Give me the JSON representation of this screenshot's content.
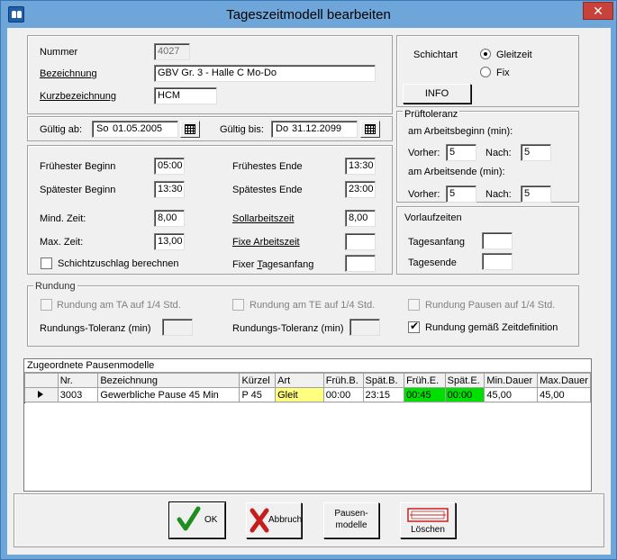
{
  "window": {
    "title": "Tageszeitmodell bearbeiten",
    "close_glyph": "✕"
  },
  "top": {
    "nummer_label": "Nummer",
    "nummer_value": "4027",
    "bezeichnung_label": "Bezeichnung",
    "bezeichnung_value": "GBV Gr. 3 - Halle C Mo-Do",
    "kurz_label": "Kurzbezeichnung",
    "kurz_value": "HCM"
  },
  "shift": {
    "label": "Schichtart",
    "gleitzeit": "Gleitzeit",
    "fix": "Fix",
    "selected": "Gleitzeit",
    "info_button": "INFO"
  },
  "validity": {
    "from_label": "Gültig ab:",
    "from_day": "So",
    "from_date": "01.05.2005",
    "to_label": "Gültig bis:",
    "to_day": "Do",
    "to_date": "31.12.2099"
  },
  "pruef": {
    "legend": "Prüftoleranz",
    "begin_label": "am Arbeitsbeginn (min):",
    "end_label": "am Arbeitsende (min):",
    "vorher_label": "Vorher:",
    "nach_label": "Nach:",
    "begin_vorher": "5",
    "begin_nach": "5",
    "end_vorher": "5",
    "end_nach": "5"
  },
  "times": {
    "fb_label": "Frühester Beginn",
    "fb_value": "05:00",
    "sb_label": "Spätester Beginn",
    "sb_value": "13:30",
    "fe_label": "Frühestes Ende",
    "fe_value": "13:30",
    "se_label": "Spätestes Ende",
    "se_value": "23:00",
    "mind_label": "Mind. Zeit:",
    "mind_value": "8,00",
    "max_label": "Max. Zeit:",
    "max_value": "13,00",
    "soll_label": "Sollarbeitszeit",
    "soll_value": "8,00",
    "fixe_label": "Fixe Arbeitszeit",
    "fixe_value": "",
    "fixta_label": "Fixer Tagesanfang",
    "fixta_value": "",
    "schicht_label": "Schichtzuschlag berechnen"
  },
  "vorlauf": {
    "legend": "Vorlaufzeiten",
    "anfang_label": "Tagesanfang",
    "anfang_value": "",
    "ende_label": "Tagesende",
    "ende_value": ""
  },
  "rundung": {
    "legend": "Rundung",
    "ta_label": "Rundung am TA auf 1/4 Std.",
    "te_label": "Rundung am TE auf 1/4 Std.",
    "pausen_label": "Rundung Pausen auf 1/4 Std.",
    "tol1_label": "Rundungs-Toleranz (min)",
    "tol2_label": "Rundungs-Toleranz (min)",
    "zeitdef_label": "Rundung gemäß Zeitdefinition"
  },
  "pausen": {
    "caption": "Zugeordnete Pausenmodelle",
    "columns": [
      "Nr.",
      "Bezeichnung",
      "Kürzel",
      "Art",
      "Früh.B.",
      "Spät.B.",
      "Früh.E.",
      "Spät.E.",
      "Min.Dauer",
      "Max.Dauer"
    ],
    "rows": [
      [
        "3003",
        "Gewerbliche Pause 45 Min",
        "P 45",
        "Gleit",
        "00:00",
        "23:15",
        "00:45",
        "00:00",
        "45,00",
        "45,00"
      ]
    ],
    "highlight": {
      "art": "#ffff80",
      "times": "#00e000"
    }
  },
  "buttons": {
    "ok": "OK",
    "abbruch": "Abbruch",
    "pausen_1": "Pausen-",
    "pausen_2": "modelle",
    "loeschen": "Löschen"
  }
}
